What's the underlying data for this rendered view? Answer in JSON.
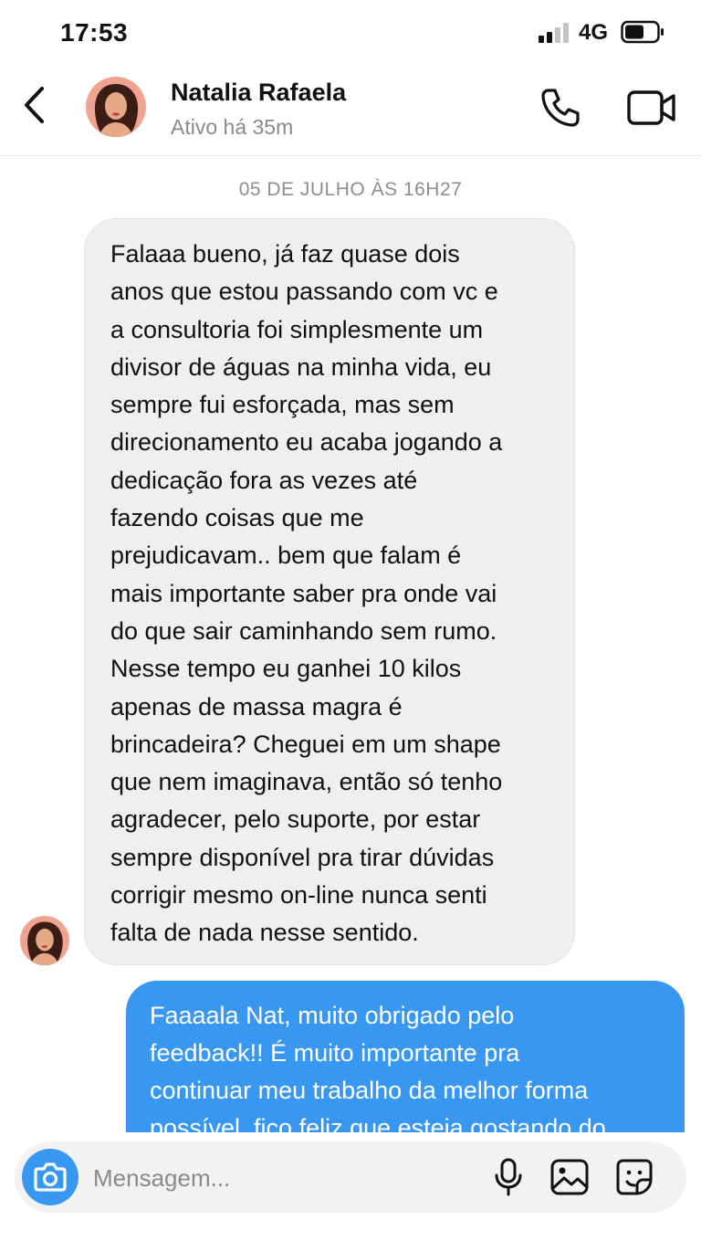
{
  "status_bar": {
    "time": "17:53",
    "network": "4G"
  },
  "header": {
    "contact_name": "Natalia Rafaela",
    "contact_status": "Ativo há 35m",
    "icons": [
      "back-chevron-icon",
      "phone-icon",
      "video-camera-icon"
    ]
  },
  "conversation": {
    "date_separator": "05 DE JULHO ÀS 16H27",
    "incoming": {
      "lines": [
        "Falaaa bueno, já faz quase dois",
        "anos que estou passando com vc e",
        "a consultoria foi simplesmente um",
        "divisor de águas na minha vida, eu",
        "sempre fui esforçada, mas sem",
        "direcionamento eu acaba jogando a",
        "dedicação fora as vezes até",
        "fazendo coisas que me",
        "prejudicavam.. bem que falam é",
        "mais importante saber pra onde vai",
        "do que sair caminhando sem rumo.",
        "Nesse tempo eu ganhei 10 kilos",
        "apenas de massa magra é",
        "brincadeira? Cheguei em um shape",
        "que nem imaginava, então só tenho",
        "agradecer, pelo suporte, por estar",
        "sempre disponível pra tirar dúvidas",
        "corrigir mesmo on-line nunca senti",
        "falta de nada nesse sentido."
      ]
    },
    "outgoing": {
      "lines": [
        "Faaaala Nat, muito obrigado pelo",
        "feedback!! É muito importante pra",
        "continuar meu trabalho da melhor forma",
        "possível, fico feliz que esteja gostando do"
      ]
    }
  },
  "composer": {
    "placeholder": "Mensagem...",
    "icons": [
      "camera-icon",
      "microphone-icon",
      "gallery-icon",
      "sticker-icon"
    ]
  },
  "colors": {
    "accent": "#3897f0",
    "incoming_bubble": "#efefef",
    "muted_text": "#8e8e8e"
  }
}
